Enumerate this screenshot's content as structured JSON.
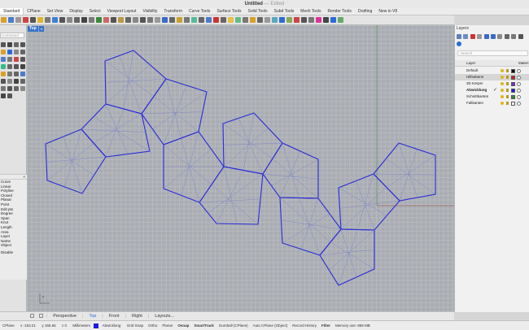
{
  "window": {
    "title": "Untitled",
    "subtitle": "— Edited"
  },
  "menu_tabs": [
    "Standard",
    "CPlane",
    "Set View",
    "Display",
    "Select",
    "Viewport Layout",
    "Visibility",
    "Transform",
    "Curve Tools",
    "Surface Tools",
    "Solid Tools",
    "Subd Tools",
    "Mesh Tools",
    "Render Tools",
    "Drafting",
    "New in V8"
  ],
  "command": {
    "placeholder": "Command"
  },
  "viewport": {
    "name": "Top",
    "accent": "#3673c8",
    "curve_color": "#2a2ad8",
    "axis_x_color": "#a04040",
    "axis_y_color": "#3b8a3b"
  },
  "object_props": {
    "items": [
      "Curve",
      "Linear",
      "Polyline",
      "Closed",
      "Planar",
      "Point",
      "Edit pts",
      "Degree",
      "Span",
      "Knot",
      "Length",
      "Area",
      "Layer",
      "Name",
      "Object"
    ],
    "footer": "Disable"
  },
  "layers_panel": {
    "title": "Layers",
    "search_placeholder": "Search",
    "col_layer": "Layer",
    "col_material": "Materi",
    "layers": [
      {
        "name": "Default",
        "current": false,
        "color": "#111111",
        "selected": false
      },
      {
        "name": "Hilfsebene",
        "current": false,
        "color": "#d41f1f",
        "selected": true
      },
      {
        "name": "3D Körper",
        "current": false,
        "color": "#7a2ad6",
        "selected": false
      },
      {
        "name": "Abwicklung",
        "current": true,
        "color": "#1a1ae0",
        "selected": false
      },
      {
        "name": "Schnittkanten",
        "current": false,
        "color": "#2e8a2e",
        "selected": false
      },
      {
        "name": "Faltkanten",
        "current": false,
        "color": "#ffffff",
        "selected": false
      }
    ]
  },
  "view_tabs": {
    "tabs": [
      "Perspective",
      "Top",
      "Front",
      "Right",
      "Layouts..."
    ],
    "active": "Top"
  },
  "status": {
    "cplane": "CPlane",
    "x": "x -153.21",
    "y": "y 155.66",
    "z": "z 0",
    "units": "Millimeters",
    "layer": "Abwicklung",
    "layer_color": "#1a1ae0",
    "toggles": [
      "Grid Snap",
      "Ortho",
      "Planar",
      "Osnap",
      "SmartTrack",
      "Gumball (CPlane)",
      "Auto CPlane (Object)",
      "Record History",
      "Filter"
    ],
    "bold_toggles": [
      "Osnap",
      "SmartTrack",
      "Filter"
    ],
    "memory": "Memory use: 858 MB"
  }
}
